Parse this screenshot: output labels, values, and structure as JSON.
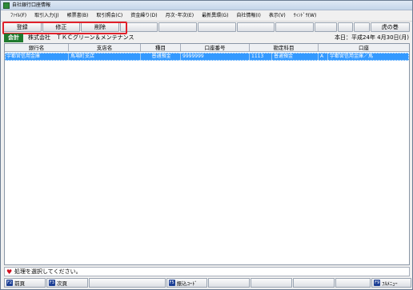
{
  "window": {
    "title": "自社銀行口座情報"
  },
  "menu": [
    "ﾌｧｲﾙ(F)",
    "取引入力(J)",
    "帳票書(B)",
    "取引照会(C)",
    "資金繰り(D)",
    "月次･年次(E)",
    "最新異環(G)",
    "自社情報(I)",
    "表示(V)",
    "ｳｨﾝﾄﾞｳ(W)"
  ],
  "toolbar": {
    "buttons": [
      "登録",
      "修正",
      "削除",
      "",
      "",
      "",
      "",
      "",
      "",
      "",
      ""
    ],
    "right_button": "虎の巻"
  },
  "company": {
    "badge": "会計",
    "name": "株式会社　ＴＫＣグリーン＆メンテナンス",
    "date": "本日：平成24年 4月30日(月)"
  },
  "grid": {
    "columns": [
      "銀行名",
      "支店名",
      "種目",
      "口座番号",
      "勘定科目",
      "口座"
    ],
    "rows": [
      [
        "宇都宮信用金庫",
        "馬場町支店",
        "普通預金",
        "9999999",
        "1113",
        "普通預金",
        "A",
        "宇都宮信用金庫／馬"
      ]
    ]
  },
  "status": {
    "message": "処理を選択してください。"
  },
  "fkeys": [
    {
      "key": "F2",
      "label": "前頁"
    },
    {
      "key": "F3",
      "label": "次頁"
    },
    {
      "key": "",
      "label": ""
    },
    {
      "key": "F5",
      "label": "振込ｺｰﾄﾞ"
    },
    {
      "key": "",
      "label": ""
    },
    {
      "key": "",
      "label": ""
    },
    {
      "key": "",
      "label": ""
    },
    {
      "key": "",
      "label": ""
    },
    {
      "key": "F9",
      "label": "ﾌﾙﾒﾆｭｰ"
    }
  ]
}
